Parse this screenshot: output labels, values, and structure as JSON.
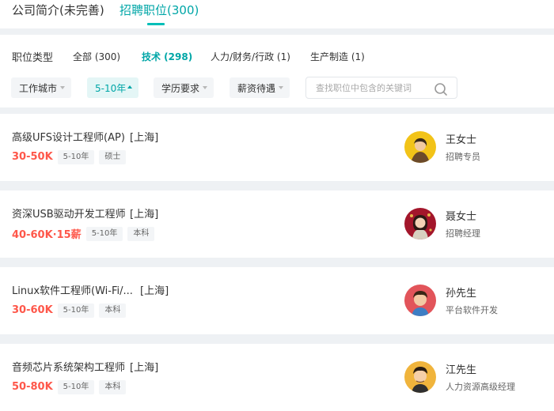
{
  "tabs": {
    "company_intro": "公司简介(未完善)",
    "jobs": "招聘职位(300)"
  },
  "filters": {
    "category_title": "职位类型",
    "categories": [
      {
        "label": "全部 (300)"
      },
      {
        "label": "技术 (298)"
      },
      {
        "label": "人力/财务/行政 (1)"
      },
      {
        "label": "生产制造 (1)"
      }
    ],
    "dropdowns": [
      {
        "label": "工作城市"
      },
      {
        "label": "5-10年"
      },
      {
        "label": "学历要求"
      },
      {
        "label": "薪资待遇"
      }
    ],
    "search_placeholder": "查找职位中包含的关键词"
  },
  "jobs": [
    {
      "title": "高级UFS设计工程师(AP)",
      "city": "[上海]",
      "salary": "30-50K",
      "tags": [
        "5-10年",
        "硕士"
      ],
      "hr_name": "王女士",
      "hr_title": "招聘专员"
    },
    {
      "title": "资深USB驱动开发工程师",
      "city": "[上海]",
      "salary": "40-60K·15薪",
      "tags": [
        "5-10年",
        "本科"
      ],
      "hr_name": "聂女士",
      "hr_title": "招聘经理"
    },
    {
      "title": "Linux软件工程师(Wi-Fi/...",
      "city": "[上海]",
      "salary": "30-60K",
      "tags": [
        "5-10年",
        "本科"
      ],
      "hr_name": "孙先生",
      "hr_title": "平台软件开发"
    },
    {
      "title": "音频芯片系统架构工程师",
      "city": "[上海]",
      "salary": "50-80K",
      "tags": [
        "5-10年",
        "本科"
      ],
      "hr_name": "江先生",
      "hr_title": "人力资源高级经理"
    }
  ],
  "colors": {
    "accent": "#00a6a7",
    "salary": "#fe574a",
    "page_bg": "#eef1f4"
  }
}
